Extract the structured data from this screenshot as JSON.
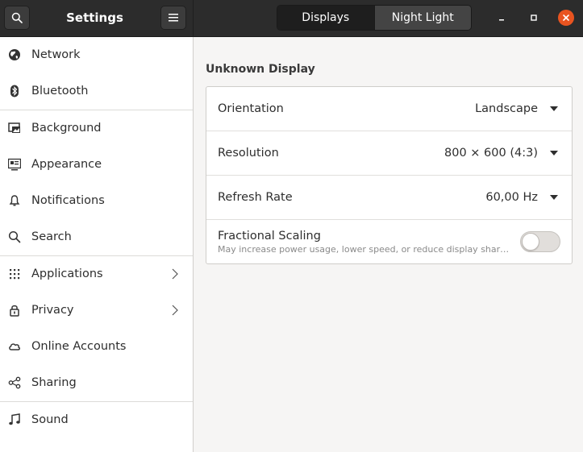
{
  "header": {
    "title": "Settings",
    "search_icon": "search-icon",
    "menu_icon": "hamburger-menu-icon",
    "tabs": [
      {
        "label": "Displays",
        "active": true
      },
      {
        "label": "Night Light",
        "active": false
      }
    ],
    "window_controls": [
      "minimize-icon",
      "maximize-icon",
      "close-icon"
    ],
    "close_color": "#e95420"
  },
  "sidebar": {
    "items": [
      {
        "label": "Network",
        "icon": "globe-icon"
      },
      {
        "label": "Bluetooth",
        "icon": "bluetooth-icon"
      },
      {
        "label": "Background",
        "icon": "background-icon"
      },
      {
        "label": "Appearance",
        "icon": "appearance-icon"
      },
      {
        "label": "Notifications",
        "icon": "bell-icon"
      },
      {
        "label": "Search",
        "icon": "search-icon"
      },
      {
        "label": "Applications",
        "icon": "apps-grid-icon",
        "has_submenu": true
      },
      {
        "label": "Privacy",
        "icon": "lock-icon",
        "has_submenu": true
      },
      {
        "label": "Online Accounts",
        "icon": "cloud-icon"
      },
      {
        "label": "Sharing",
        "icon": "share-icon"
      },
      {
        "label": "Sound",
        "icon": "music-note-icon"
      }
    ]
  },
  "main": {
    "section_title": "Unknown Display",
    "rows": [
      {
        "label": "Orientation",
        "value": "Landscape"
      },
      {
        "label": "Resolution",
        "value": "800 × 600 (4:3)"
      },
      {
        "label": "Refresh Rate",
        "value": "60,00 Hz"
      }
    ],
    "fractional_scaling": {
      "label": "Fractional Scaling",
      "description": "May increase power usage, lower speed, or reduce display sharpness.",
      "enabled": false
    }
  }
}
